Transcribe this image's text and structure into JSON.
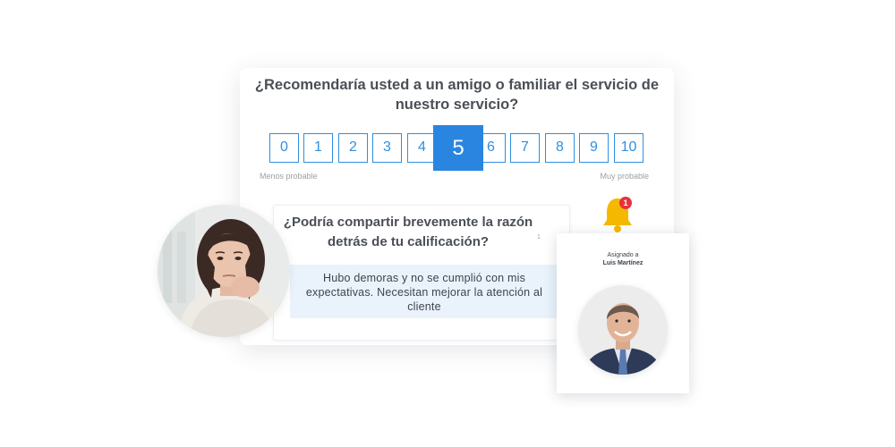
{
  "survey": {
    "question": "¿Recomendaría usted a un amigo o familiar el servicio de nuestro servicio?",
    "scale": [
      "0",
      "1",
      "2",
      "3",
      "4",
      "5",
      "6",
      "7",
      "8",
      "9",
      "10"
    ],
    "selected": "5",
    "low_label": "Menos probable",
    "high_label": "Muy probable"
  },
  "followup": {
    "question": "¿Podría compartir brevemente la razón detrás de tu calificación?",
    "answer": "Hubo demoras y no se cumplió con mis expectativas. Necesitan mejorar la atención al cliente",
    "marker": "1"
  },
  "notification": {
    "count": "1",
    "icon": "bell-icon",
    "badge_color": "#e8323c",
    "bell_color": "#f5b800"
  },
  "assignment": {
    "label": "Asignado a",
    "assignee": "Luis Martínez"
  },
  "colors": {
    "accent": "#2a85e0",
    "answer_bg": "#eaf3fc"
  }
}
